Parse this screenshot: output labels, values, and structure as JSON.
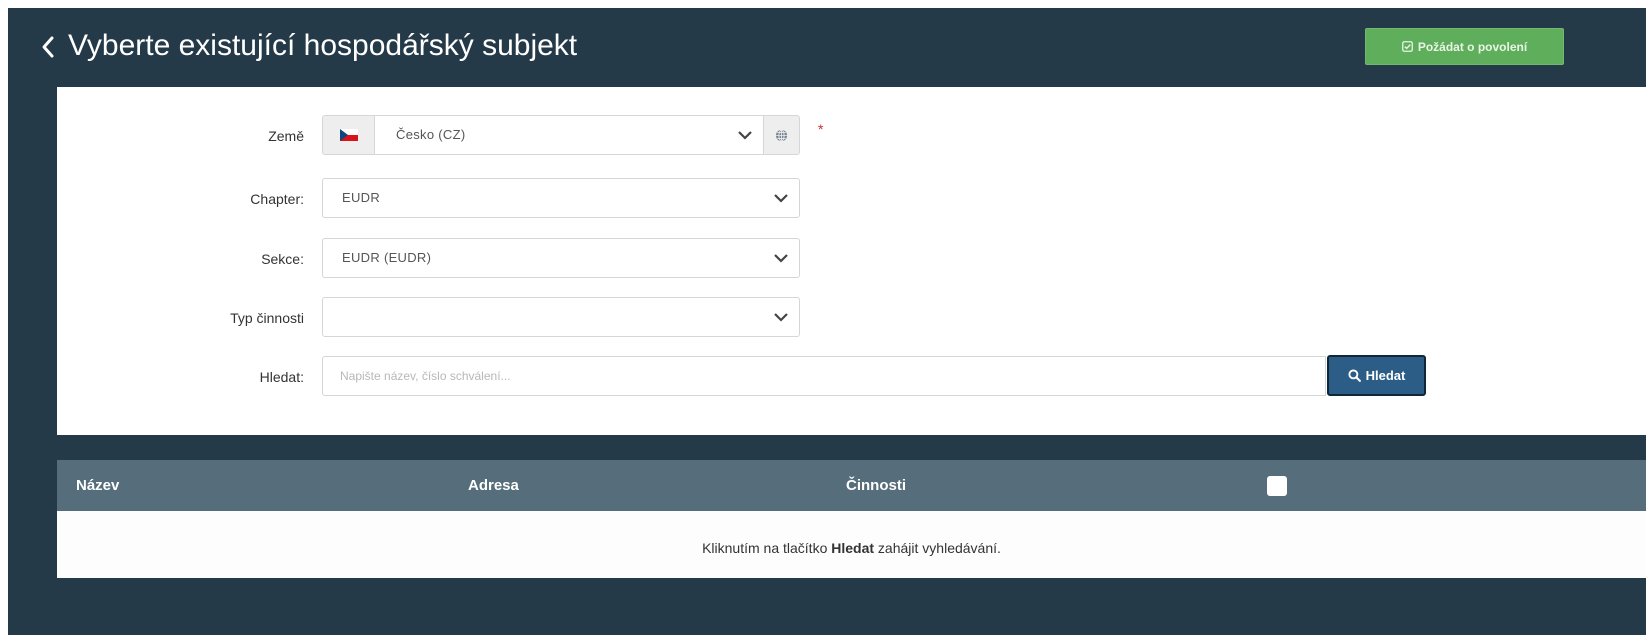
{
  "header": {
    "title": "Vyberte existující hospodářský subjekt",
    "back_icon": "chevron-left-icon",
    "request_permit_label": "Požádat o povolení",
    "request_permit_icon": "checkbox-check-icon"
  },
  "form": {
    "country": {
      "label": "Země",
      "value": "Česko (CZ)",
      "flag": "czech-flag-icon",
      "required_mark": "*"
    },
    "chapter": {
      "label": "Chapter:",
      "value": "EUDR"
    },
    "section": {
      "label": "Sekce:",
      "value": "EUDR (EUDR)"
    },
    "activity_type": {
      "label": "Typ činnosti",
      "value": ""
    },
    "search": {
      "label": "Hledat:",
      "placeholder": "Napište název, číslo schválení...",
      "button_label": "Hledat",
      "button_icon": "search-icon"
    }
  },
  "table": {
    "columns": [
      "Název",
      "Adresa",
      "Činnosti"
    ],
    "empty_message_before": "Kliknutím na tlačítko ",
    "empty_message_bold": "Hledat",
    "empty_message_after": " zahájit vyhledávání."
  },
  "colors": {
    "background": "#253a48",
    "primary_button": "#2c5d86",
    "success_button": "#5fae5b",
    "table_header": "#566d7b",
    "required": "#c9302c"
  }
}
